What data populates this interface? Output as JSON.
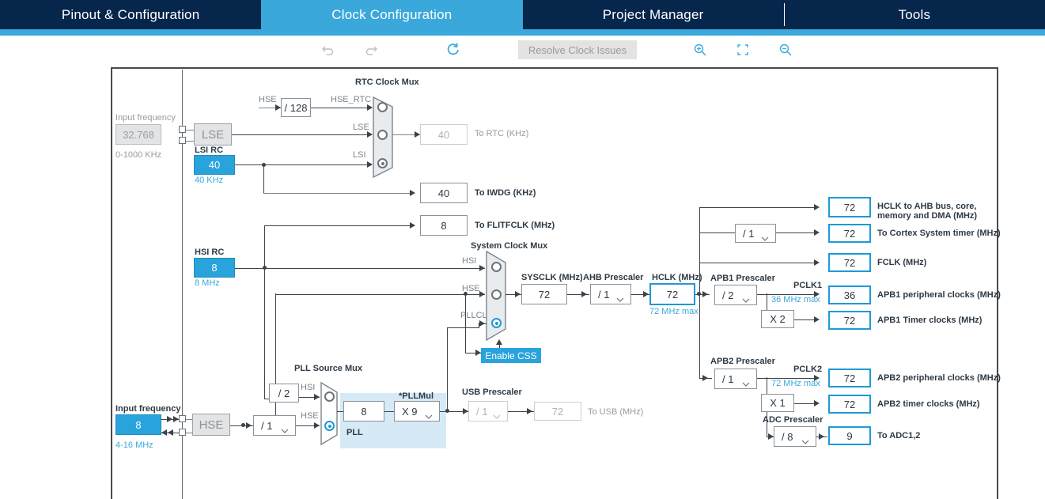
{
  "tabs": [
    {
      "label": "Pinout & Configuration",
      "active": false
    },
    {
      "label": "Clock Configuration",
      "active": true
    },
    {
      "label": "Project Manager",
      "active": false
    },
    {
      "label": "Tools",
      "active": false
    }
  ],
  "toolbar": {
    "undo": "undo-icon",
    "redo": "redo-icon",
    "reset": "reset-icon",
    "resolve_label": "Resolve Clock Issues",
    "zoom_in": "zoom-in-icon",
    "fit": "fit-to-screen-icon",
    "zoom_out": "zoom-out-icon"
  },
  "diagram": {
    "lse": {
      "input_frequency_label": "Input frequency",
      "input_frequency_value": "32.768",
      "range": "0-1000 KHz",
      "source_label": "LSE"
    },
    "lsi": {
      "title": "LSI RC",
      "value": "40",
      "unit": "40 KHz"
    },
    "hsi": {
      "title": "HSI RC",
      "value": "8",
      "unit": "8 MHz"
    },
    "hse": {
      "input_frequency_label": "Input frequency",
      "input_frequency_value": "8",
      "range": "4-16 MHz",
      "source_label": "HSE",
      "divider": "/ 1"
    },
    "rtc_mux": {
      "title": "RTC Clock Mux",
      "hse_label": "HSE",
      "hse_div": "/ 128",
      "hse_rtc_label": "HSE_RTC",
      "lse_label": "LSE",
      "lsi_label": "LSI"
    },
    "outputs_left": [
      {
        "name": "to-rtc",
        "value": "40",
        "label": "To RTC (KHz)",
        "disabled": true
      },
      {
        "name": "to-iwdg",
        "value": "40",
        "label": "To IWDG (KHz)",
        "disabled": false
      },
      {
        "name": "to-flitfclk",
        "value": "8",
        "label": "To FLITFCLK (MHz)",
        "disabled": false
      }
    ],
    "system_clock_mux": {
      "title": "System Clock Mux",
      "hsi_label": "HSI",
      "hse_label": "HSE",
      "pllclk_label": "PLLCLK",
      "css_label": "Enable CSS"
    },
    "pll_source_mux": {
      "title": "PLL Source Mux",
      "hsi_div": "/ 2",
      "hsi_label": "HSI",
      "hse_label": "HSE",
      "pll_label": "PLL",
      "pll_input": "8",
      "pllmul_label": "*PLLMul",
      "pllmul_value": "X 9"
    },
    "sysclk": {
      "title": "SYSCLK (MHz)",
      "value": "72"
    },
    "ahb_prescaler": {
      "title": "AHB Prescaler",
      "value": "/ 1"
    },
    "hclk": {
      "title": "HCLK (MHz)",
      "value": "72",
      "max": "72 MHz max"
    },
    "usb": {
      "title": "USB Prescaler",
      "value": "/ 1",
      "out": "72",
      "label": "To USB (MHz)"
    },
    "ahb_outputs": [
      {
        "name": "hclk-ahb-bus",
        "value": "72",
        "label_line1": "HCLK to AHB bus, core,",
        "label_line2": "memory and DMA (MHz)"
      },
      {
        "name": "cortex-system-timer",
        "value": "72",
        "label": "To Cortex System timer (MHz)",
        "prescaler": "/ 1"
      },
      {
        "name": "fclk",
        "value": "72",
        "label": "FCLK (MHz)"
      }
    ],
    "apb1": {
      "title": "APB1 Prescaler",
      "prescaler": "/ 2",
      "pclk_name": "PCLK1",
      "max": "36 MHz max",
      "peripheral_value": "36",
      "peripheral_label": "APB1 peripheral clocks (MHz)",
      "timer_mul": "X 2",
      "timer_value": "72",
      "timer_label": "APB1 Timer clocks (MHz)"
    },
    "apb2": {
      "title": "APB2 Prescaler",
      "prescaler": "/ 1",
      "pclk_name": "PCLK2",
      "max": "72 MHz max",
      "peripheral_value": "72",
      "peripheral_label": "APB2 peripheral clocks (MHz)",
      "timer_mul": "X 1",
      "timer_value": "72",
      "timer_label": "APB2 timer clocks (MHz)",
      "adc_title": "ADC Prescaler",
      "adc_prescaler": "/ 8",
      "adc_value": "9",
      "adc_label": "To ADC1,2"
    }
  },
  "colors": {
    "navy": "#06264c",
    "accent": "#3aa8db",
    "cyan": "#29a3dc",
    "blue_border": "#1e9ad6",
    "pll_bg": "#d6e9f6"
  }
}
